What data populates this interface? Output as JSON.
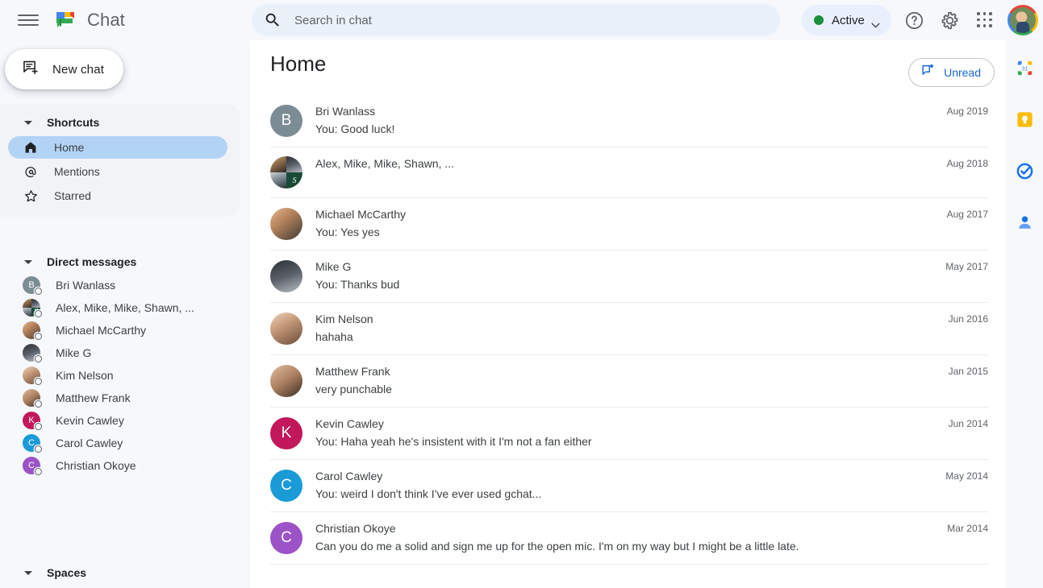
{
  "header": {
    "menu_icon": "hamburger-menu-icon",
    "logo_icon": "google-chat-logo",
    "app_name": "Chat",
    "search": {
      "icon": "search-icon",
      "placeholder": "Search in chat",
      "value": ""
    },
    "status": {
      "label": "Active",
      "dot_color": "#1e8e3e",
      "caret_icon": "chevron-down-icon",
      "pill_bg": "#e8f0fe"
    },
    "help_icon": "help-circle-icon",
    "settings_icon": "gear-icon",
    "apps_icon": "apps-grid-icon",
    "account_icon": "account-avatar"
  },
  "sidebar": {
    "new_chat": {
      "label": "New chat",
      "icon": "new-chat-icon"
    },
    "shortcuts": {
      "title": "Shortcuts",
      "caret_icon": "caret-down-icon",
      "items": [
        {
          "label": "Home",
          "icon": "home-icon",
          "active": true
        },
        {
          "label": "Mentions",
          "icon": "at-mention-icon",
          "active": false
        },
        {
          "label": "Starred",
          "icon": "star-icon",
          "active": false
        }
      ]
    },
    "direct_messages": {
      "title": "Direct messages",
      "caret_icon": "caret-down-icon",
      "items": [
        {
          "label": "Bri Wanlass",
          "avatar_type": "initial",
          "initial": "B",
          "color": "#7c8c95"
        },
        {
          "label": "Alex, Mike, Mike, Shawn, ...",
          "avatar_type": "group",
          "color": ""
        },
        {
          "label": "Michael McCarthy",
          "avatar_type": "photo",
          "photo": "ph3"
        },
        {
          "label": "Mike G",
          "avatar_type": "photo",
          "photo": "ph2"
        },
        {
          "label": "Kim Nelson",
          "avatar_type": "photo",
          "photo": "ph6"
        },
        {
          "label": "Matthew Frank",
          "avatar_type": "photo",
          "photo": "ph7"
        },
        {
          "label": "Kevin Cawley",
          "avatar_type": "initial",
          "initial": "K",
          "color": "#c2185b"
        },
        {
          "label": "Carol Cawley",
          "avatar_type": "initial",
          "initial": "C",
          "color": "#1a9ad7"
        },
        {
          "label": "Christian Okoye",
          "avatar_type": "initial",
          "initial": "C",
          "color": "#9c53c7"
        }
      ]
    },
    "spaces": {
      "title": "Spaces",
      "caret_icon": "caret-down-icon"
    }
  },
  "main": {
    "title": "Home",
    "unread_button": {
      "label": "Unread",
      "icon": "unread-chat-icon",
      "color": "#1967d2"
    },
    "conversations": [
      {
        "name": "Bri Wanlass",
        "preview": "You: Good luck!",
        "time": "Aug 2019",
        "avatar_type": "initial",
        "initial": "B",
        "color": "#7c8c95"
      },
      {
        "name": "Alex, Mike, Mike, Shawn, ...",
        "preview": "",
        "time": "Aug 2018",
        "avatar_type": "group",
        "group_initial": "S",
        "color": ""
      },
      {
        "name": "Michael McCarthy",
        "preview": "You: Yes yes",
        "time": "Aug 2017",
        "avatar_type": "photo",
        "photo": "ph3",
        "color": ""
      },
      {
        "name": "Mike G",
        "preview": "You: Thanks bud",
        "time": "May 2017",
        "avatar_type": "photo",
        "photo": "ph2",
        "color": ""
      },
      {
        "name": "Kim Nelson",
        "preview": "hahaha",
        "time": "Jun 2016",
        "avatar_type": "photo",
        "photo": "ph6",
        "color": ""
      },
      {
        "name": "Matthew Frank",
        "preview": "very punchable",
        "time": "Jan 2015",
        "avatar_type": "photo",
        "photo": "ph7",
        "color": ""
      },
      {
        "name": "Kevin Cawley",
        "preview": "You: Haha yeah he's insistent with it I'm not a fan either",
        "time": "Jun 2014",
        "avatar_type": "initial",
        "initial": "K",
        "color": "#c2185b"
      },
      {
        "name": "Carol Cawley",
        "preview": "You: weird I don't think I've ever used gchat...",
        "time": "May 2014",
        "avatar_type": "initial",
        "initial": "C",
        "color": "#1a9ad7"
      },
      {
        "name": "Christian Okoye",
        "preview": "Can you do me a solid and sign me up for the open mic. I'm on my way but I might be a little late.",
        "time": "Mar 2014",
        "avatar_type": "initial",
        "initial": "C",
        "color": "#9c53c7"
      }
    ]
  },
  "right_rail": {
    "items": [
      {
        "icon": "google-calendar-icon",
        "label": "Calendar",
        "day": "31"
      },
      {
        "icon": "google-keep-icon",
        "label": "Keep"
      },
      {
        "icon": "google-tasks-icon",
        "label": "Tasks"
      },
      {
        "icon": "google-contacts-icon",
        "label": "Contacts"
      }
    ]
  }
}
